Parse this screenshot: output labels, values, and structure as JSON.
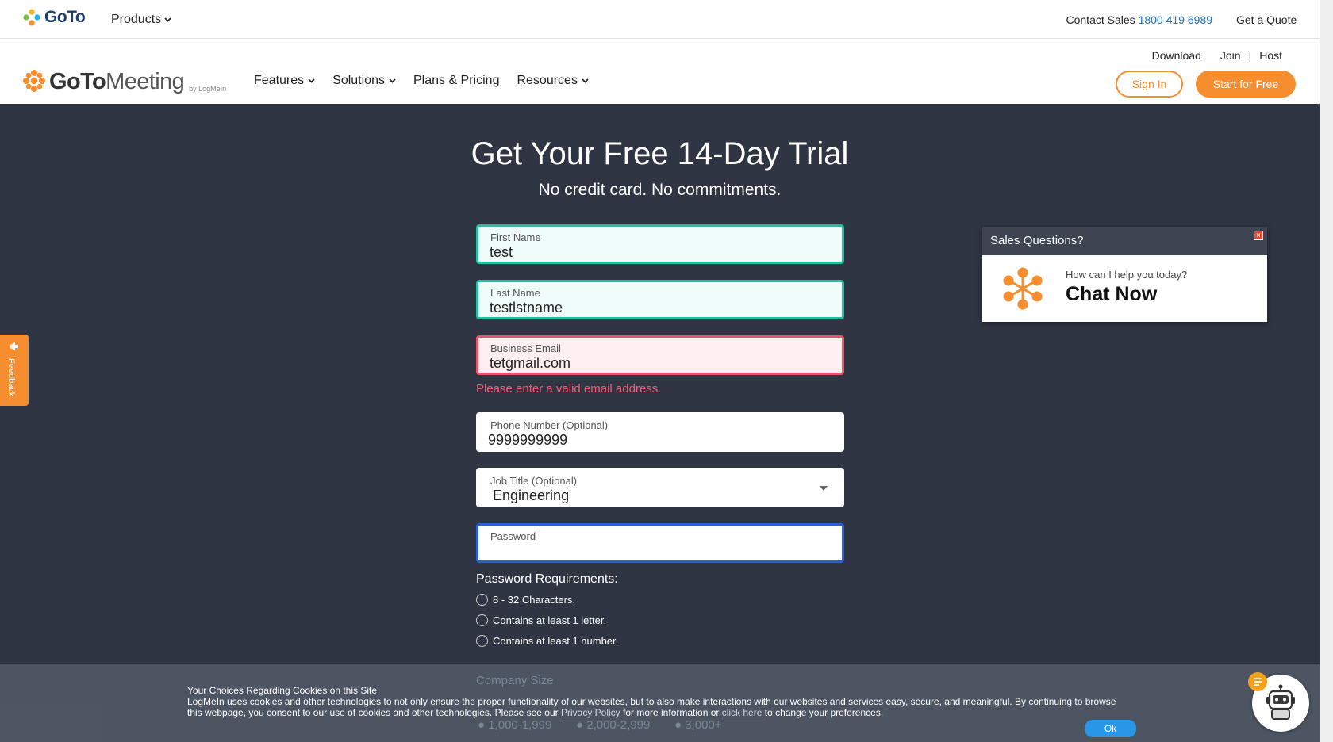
{
  "topbar": {
    "brand": "GoTo",
    "products_label": "Products",
    "contact_label": "Contact Sales",
    "contact_phone": "1800 419 6989",
    "quote_label": "Get a Quote"
  },
  "nav": {
    "brand_goto": "GoTo",
    "brand_meeting": "Meeting",
    "brand_by": "by LogMeIn",
    "links": [
      "Features",
      "Solutions",
      "Plans & Pricing",
      "Resources"
    ],
    "download": "Download",
    "join": "Join",
    "separator": "|",
    "host": "Host",
    "signin": "Sign In",
    "start": "Start for Free"
  },
  "hero": {
    "title": "Get Your Free 14-Day Trial",
    "subtitle": "No credit card. No commitments."
  },
  "form": {
    "first_name": {
      "label": "First Name",
      "value": "test"
    },
    "last_name": {
      "label": "Last Name",
      "value": "testlstname"
    },
    "email": {
      "label": "Business Email",
      "value": "tetgmail.com",
      "error": "Please enter a valid email address."
    },
    "phone": {
      "label": "Phone Number (Optional)",
      "value": "9999999999"
    },
    "job_title": {
      "label": "Job Title (Optional)",
      "value": "Engineering"
    },
    "password": {
      "label": "Password",
      "value": ""
    },
    "pw_requirements": {
      "heading": "Password Requirements:",
      "items": [
        "8 - 32 Characters.",
        "Contains at least 1 letter.",
        "Contains at least 1 number."
      ]
    },
    "company_size": {
      "label": "Company Size",
      "options": [
        "1,000-1,999",
        "2,000-2,999",
        "3,000+"
      ]
    }
  },
  "chat": {
    "header": "Sales Questions?",
    "close": "×",
    "question": "How can I help you today?",
    "cta": "Chat Now"
  },
  "feedback": {
    "label": "Feedback"
  },
  "cookie": {
    "title": "Your Choices Regarding Cookies on this Site",
    "body_1": "LogMeIn uses cookies and other technologies to not only ensure the proper functionality of our websites, but to also make interactions with our websites and services easy, secure, and meaningful. By continuing to browse this webpage, you consent to our use of cookies and other technologies. Please see our ",
    "privacy_link": "Privacy Policy",
    "body_2": " for more information or ",
    "click_link": "click here",
    "body_3": " to change your preferences.",
    "ok": "Ok"
  },
  "colors": {
    "accent": "#f68d2e",
    "hero_bg": "#2f3542",
    "valid_border": "#23bfa0",
    "error_border": "#e6566a",
    "focus_border": "#2b5fd9",
    "link_blue": "#1e73be"
  }
}
